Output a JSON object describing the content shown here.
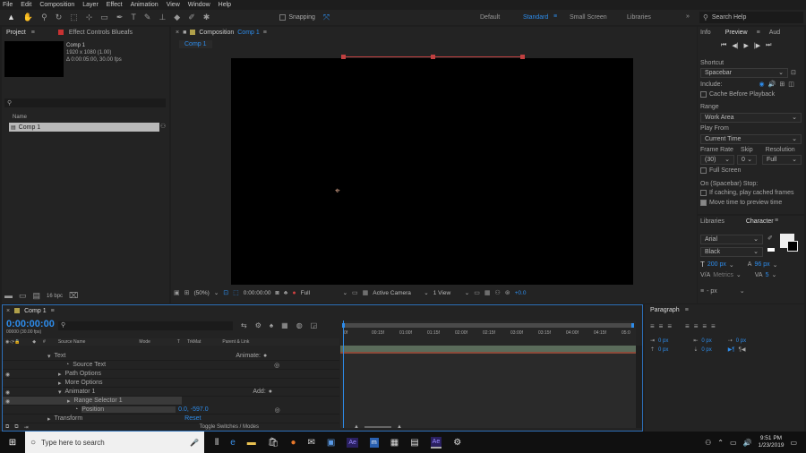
{
  "menu": [
    "File",
    "Edit",
    "Composition",
    "Layer",
    "Effect",
    "Animation",
    "View",
    "Window",
    "Help"
  ],
  "toolbar": {
    "snapping": "Snapping"
  },
  "workspaces": [
    "Default",
    "Standard",
    "Small Screen",
    "Libraries"
  ],
  "search": {
    "placeholder": "Search Help"
  },
  "project": {
    "tab": "Project",
    "effect_controls": "Effect Controls Blueafs",
    "comp_name": "Comp 1",
    "comp_res": "1920 x 1080 (1.00)",
    "comp_dur": "Δ 0:00:05:00, 30.00 fps",
    "col_name": "Name",
    "item": "Comp 1",
    "bpc": "16 bpc"
  },
  "viewer": {
    "tab": "Composition",
    "comp_link": "Comp 1",
    "sub_tab": "Comp 1",
    "zoom": "(50%)",
    "time": "0:00:00:00",
    "quality": "Full",
    "camera": "Active Camera",
    "views": "1 View",
    "exposure": "+0.0"
  },
  "info": {
    "tabs": [
      "Info",
      "Preview",
      "Aud"
    ],
    "shortcut_label": "Shortcut",
    "shortcut": "Spacebar",
    "include": "Include:",
    "cache": "Cache Before Playback",
    "range_label": "Range",
    "range": "Work Area",
    "playfrom_label": "Play From",
    "playfrom": "Current Time",
    "framerate_label": "Frame Rate",
    "skip_label": "Skip",
    "res_label": "Resolution",
    "framerate": "(30)",
    "skip": "0",
    "res": "Full",
    "fullscreen": "Full Screen",
    "stop_label": "On (Spacebar) Stop:",
    "if_caching": "If caching, play cached frames",
    "move_time": "Move time to preview time"
  },
  "character": {
    "tabs": [
      "Libraries",
      "Character"
    ],
    "font": "Arial",
    "style": "Black",
    "size": "200 px",
    "leading": "96 px",
    "kerning": "Metrics",
    "tracking": "5",
    "baseline": "- px"
  },
  "paragraph": {
    "tab": "Paragraph",
    "v1": "0 px",
    "v2": "0 px",
    "v3": "0 px",
    "v4": "0 px",
    "v5": "0 px"
  },
  "timeline": {
    "tab": "Comp 1",
    "timecode": "0:00:00:00",
    "fps": "00000 (30.00 fps)",
    "search_placeholder": "",
    "cols": [
      "#",
      "Source Name",
      "Mode",
      "T",
      "TrkMat",
      "Parent & Link"
    ],
    "ruler": [
      "0f",
      "00:15f",
      "01:00f",
      "01:15f",
      "02:00f",
      "02:15f",
      "03:00f",
      "03:15f",
      "04:00f",
      "04:15f",
      "05:0"
    ],
    "rows": [
      {
        "label": "Text",
        "indent": 1,
        "right": "Animate:"
      },
      {
        "label": "Source Text",
        "indent": 3,
        "right": ""
      },
      {
        "label": "Path Options",
        "indent": 2,
        "right": ""
      },
      {
        "label": "More Options",
        "indent": 2,
        "right": ""
      },
      {
        "label": "Animator 1",
        "indent": 2,
        "right": "Add:"
      },
      {
        "label": "Range Selector 1",
        "indent": 3,
        "right": ""
      },
      {
        "label": "Position",
        "indent": 3,
        "right": "",
        "value": "0.0, -597.0"
      },
      {
        "label": "Transform",
        "indent": 1,
        "right": "",
        "value": "Reset"
      }
    ],
    "toggle": "Toggle Switches / Modes"
  },
  "taskbar": {
    "search": "Type here to search",
    "time": "9:51 PM",
    "date": "1/23/2019"
  },
  "colors": {
    "accent": "#2d8ceb",
    "panel": "#232323",
    "bg": "#1a1a1a"
  }
}
